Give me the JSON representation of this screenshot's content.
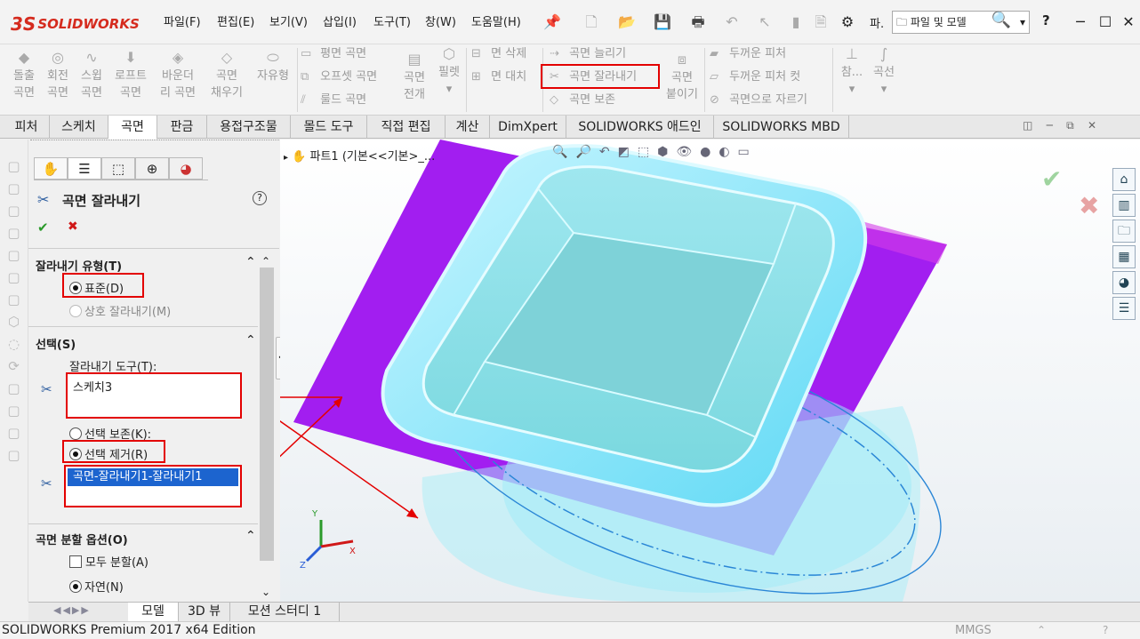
{
  "app": {
    "logo_text": "SOLIDWORKS",
    "logo_prefix": "3S"
  },
  "menu": [
    "파일(F)",
    "편집(E)",
    "보기(V)",
    "삽입(I)",
    "도구(T)",
    "창(W)",
    "도움말(H)"
  ],
  "toolbar_right": {
    "question": "?",
    "more": "파.",
    "search_placeholder": "파일 및 모델"
  },
  "ribbon": {
    "big": [
      {
        "icon": "extrude-icon",
        "label1": "돌출",
        "label2": "곡면"
      },
      {
        "icon": "revolve-icon",
        "label1": "회전",
        "label2": "곡면"
      },
      {
        "icon": "sweep-icon",
        "label1": "스윕",
        "label2": "곡면"
      },
      {
        "icon": "loft-icon",
        "label1": "로프트",
        "label2": "곡면"
      },
      {
        "icon": "boundary-icon",
        "label1": "바운더",
        "label2": "리 곡면"
      },
      {
        "icon": "fill-icon",
        "label1": "곡면",
        "label2": "채우기"
      },
      {
        "icon": "freeform-icon",
        "label1": "자유형",
        "label2": ""
      }
    ],
    "col1": [
      "평면 곡면",
      "오프셋 곡면",
      "룰드 곡면"
    ],
    "flatten": {
      "label1": "곡면",
      "label2": "전개"
    },
    "ruled_more": "필렛",
    "col2": [
      "면 삭제",
      "면 대치"
    ],
    "col3": [
      "곡면 늘리기",
      "곡면 잘라내기",
      "곡면 보존"
    ],
    "knit": {
      "label1": "곡면",
      "label2": "붙이기"
    },
    "col4": [
      "두꺼운 피처",
      "두꺼운 피처 컷",
      "곡면으로 자르기"
    ],
    "ref": "참...",
    "curve": "곡선"
  },
  "tabs": [
    "피처",
    "스케치",
    "곡면",
    "판금",
    "용접구조물",
    "몰드 도구",
    "직접 편집",
    "계산",
    "DimXpert",
    "SOLIDWORKS 애드인",
    "SOLIDWORKS MBD"
  ],
  "active_tab": "곡면",
  "pm": {
    "title": "곡면 잘라내기",
    "ok": "✔",
    "cancel": "✖",
    "help": "?",
    "trim_type": {
      "header": "잘라내기 유형(T)",
      "standard": "표준(D)",
      "mutual": "상호 잘라내기(M)"
    },
    "selection": {
      "header": "선택(S)",
      "tool_label": "잘라내기 도구(T):",
      "tool_value": "스케치3",
      "keep": "선택 보존(K):",
      "remove": "선택 제거(R)",
      "removed_item": "곡면-잘라내기1-잘라내기1"
    },
    "split": {
      "header": "곡면 분할 옵션(O)",
      "all": "모두 분할(A)",
      "natural": "자연(N)"
    }
  },
  "viewport": {
    "tree_label": "파트1  (기본<<기본>_..."
  },
  "bottom_tabs": [
    "모델",
    "3D 뷰",
    "모션 스터디 1"
  ],
  "status": {
    "left": "SOLIDWORKS Premium 2017 x64 Edition",
    "units": "MMGS"
  },
  "colors": {
    "highlight": "#e30000",
    "purple": "#a21ef0",
    "cyan": "#6fe9ff",
    "selection": "#1c64cf"
  }
}
